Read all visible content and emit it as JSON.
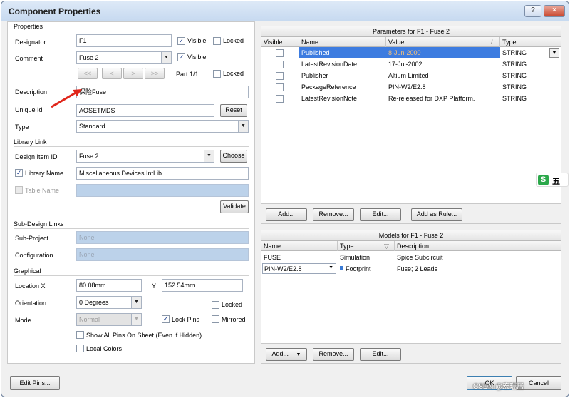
{
  "window": {
    "title": "Component Properties",
    "help_label": "?",
    "close_label": "×"
  },
  "properties": {
    "group_title": "Properties",
    "designator_label": "Designator",
    "designator_value": "F1",
    "visible_label": "Visible",
    "locked_label": "Locked",
    "comment_label": "Comment",
    "comment_value": "Fuse 2",
    "nav_buttons": [
      "<<",
      "<",
      ">",
      ">>"
    ],
    "part_label": "Part 1/1",
    "description_label": "Description",
    "description_value": "保险Fuse",
    "unique_id_label": "Unique Id",
    "unique_id_value": "AOSETMDS",
    "reset_label": "Reset",
    "type_label": "Type",
    "type_value": "Standard"
  },
  "library_link": {
    "group_title": "Library Link",
    "design_item_label": "Design Item ID",
    "design_item_value": "Fuse 2",
    "choose_label": "Choose",
    "library_name_label": "Library Name",
    "library_name_value": "Miscellaneous Devices.IntLib",
    "table_name_label": "Table Name",
    "validate_label": "Validate"
  },
  "sub_design": {
    "group_title": "Sub-Design Links",
    "sub_project_label": "Sub-Project",
    "sub_project_value": "None",
    "configuration_label": "Configuration",
    "configuration_value": "None"
  },
  "graphical": {
    "group_title": "Graphical",
    "location_label": "Location X",
    "x_value": "80.08mm",
    "y_label": "Y",
    "y_value": "152.54mm",
    "orientation_label": "Orientation",
    "orientation_value": "0 Degrees",
    "locked_label": "Locked",
    "mode_label": "Mode",
    "mode_value": "Normal",
    "lock_pins_label": "Lock Pins",
    "mirrored_label": "Mirrored",
    "show_pins_label": "Show All Pins On Sheet (Even if Hidden)",
    "local_colors_label": "Local Colors"
  },
  "parameters": {
    "title": "Parameters for F1 - Fuse 2",
    "columns": [
      "Visible",
      "Name",
      "Value",
      "Type"
    ],
    "rows": [
      {
        "name": "Published",
        "value": "8-Jun-2000",
        "type": "STRING"
      },
      {
        "name": "LatestRevisionDate",
        "value": "17-Jul-2002",
        "type": "STRING"
      },
      {
        "name": "Publisher",
        "value": "Altium Limited",
        "type": "STRING"
      },
      {
        "name": "PackageReference",
        "value": "PIN-W2/E2.8",
        "type": "STRING"
      },
      {
        "name": "LatestRevisionNote",
        "value": "Re-released for DXP Platform.",
        "type": "STRING"
      }
    ],
    "buttons": [
      "Add...",
      "Remove...",
      "Edit...",
      "Add as Rule..."
    ]
  },
  "models": {
    "title": "Models for F1 - Fuse 2",
    "columns": [
      "Name",
      "Type",
      "Description"
    ],
    "rows": [
      {
        "name": "FUSE",
        "type": "Simulation",
        "description": "Spice Subcircuit"
      },
      {
        "name": "PIN-W2/E2.8",
        "type": "Footprint",
        "description": "Fuse; 2 Leads"
      }
    ],
    "buttons": [
      "Add...",
      "Remove...",
      "Edit..."
    ]
  },
  "footer": {
    "edit_pins_label": "Edit Pins...",
    "ok_label": "OK",
    "cancel_label": "Cancel",
    "watermark": "CSDN @宏瑞居"
  },
  "side_widget": {
    "logo_text": "S",
    "label": "五"
  },
  "colors": {
    "selection": "#3d7ce0",
    "arrow": "#e0261b",
    "disabled_field": "#bcd2ea"
  }
}
